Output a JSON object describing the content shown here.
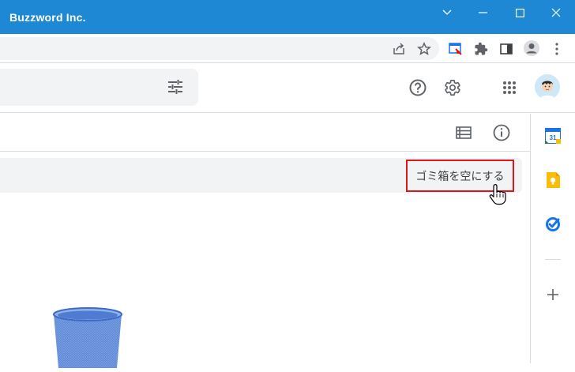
{
  "window": {
    "title": "Buzzword Inc.",
    "controls": [
      "chevron-down-icon",
      "minimize-icon",
      "maximize-icon",
      "close-icon"
    ]
  },
  "browser_toolbar": {
    "icons": [
      "share-icon",
      "star-icon",
      "extension-capture-icon",
      "puzzle-icon",
      "side-panel-icon",
      "profile-icon",
      "more-vert-icon"
    ]
  },
  "app_header": {
    "icons": [
      "tune-icon",
      "help-icon",
      "settings-icon",
      "apps-grid-icon"
    ],
    "avatar_alt": "avatar"
  },
  "main": {
    "toolbar_icons": [
      "list-view-icon",
      "info-icon"
    ],
    "banner": {
      "empty_trash_label": "ゴミ箱を空にする"
    }
  },
  "side_panel": {
    "icons": [
      "calendar-icon",
      "keep-icon",
      "tasks-icon",
      "add-icon"
    ],
    "calendar_day": "31"
  },
  "colors": {
    "titlebar": "#1e88d4",
    "highlight_border": "#e0161b",
    "banner_bg": "#f1f3f4",
    "keep_yellow": "#fbbc04",
    "tasks_blue": "#1a73e8"
  }
}
